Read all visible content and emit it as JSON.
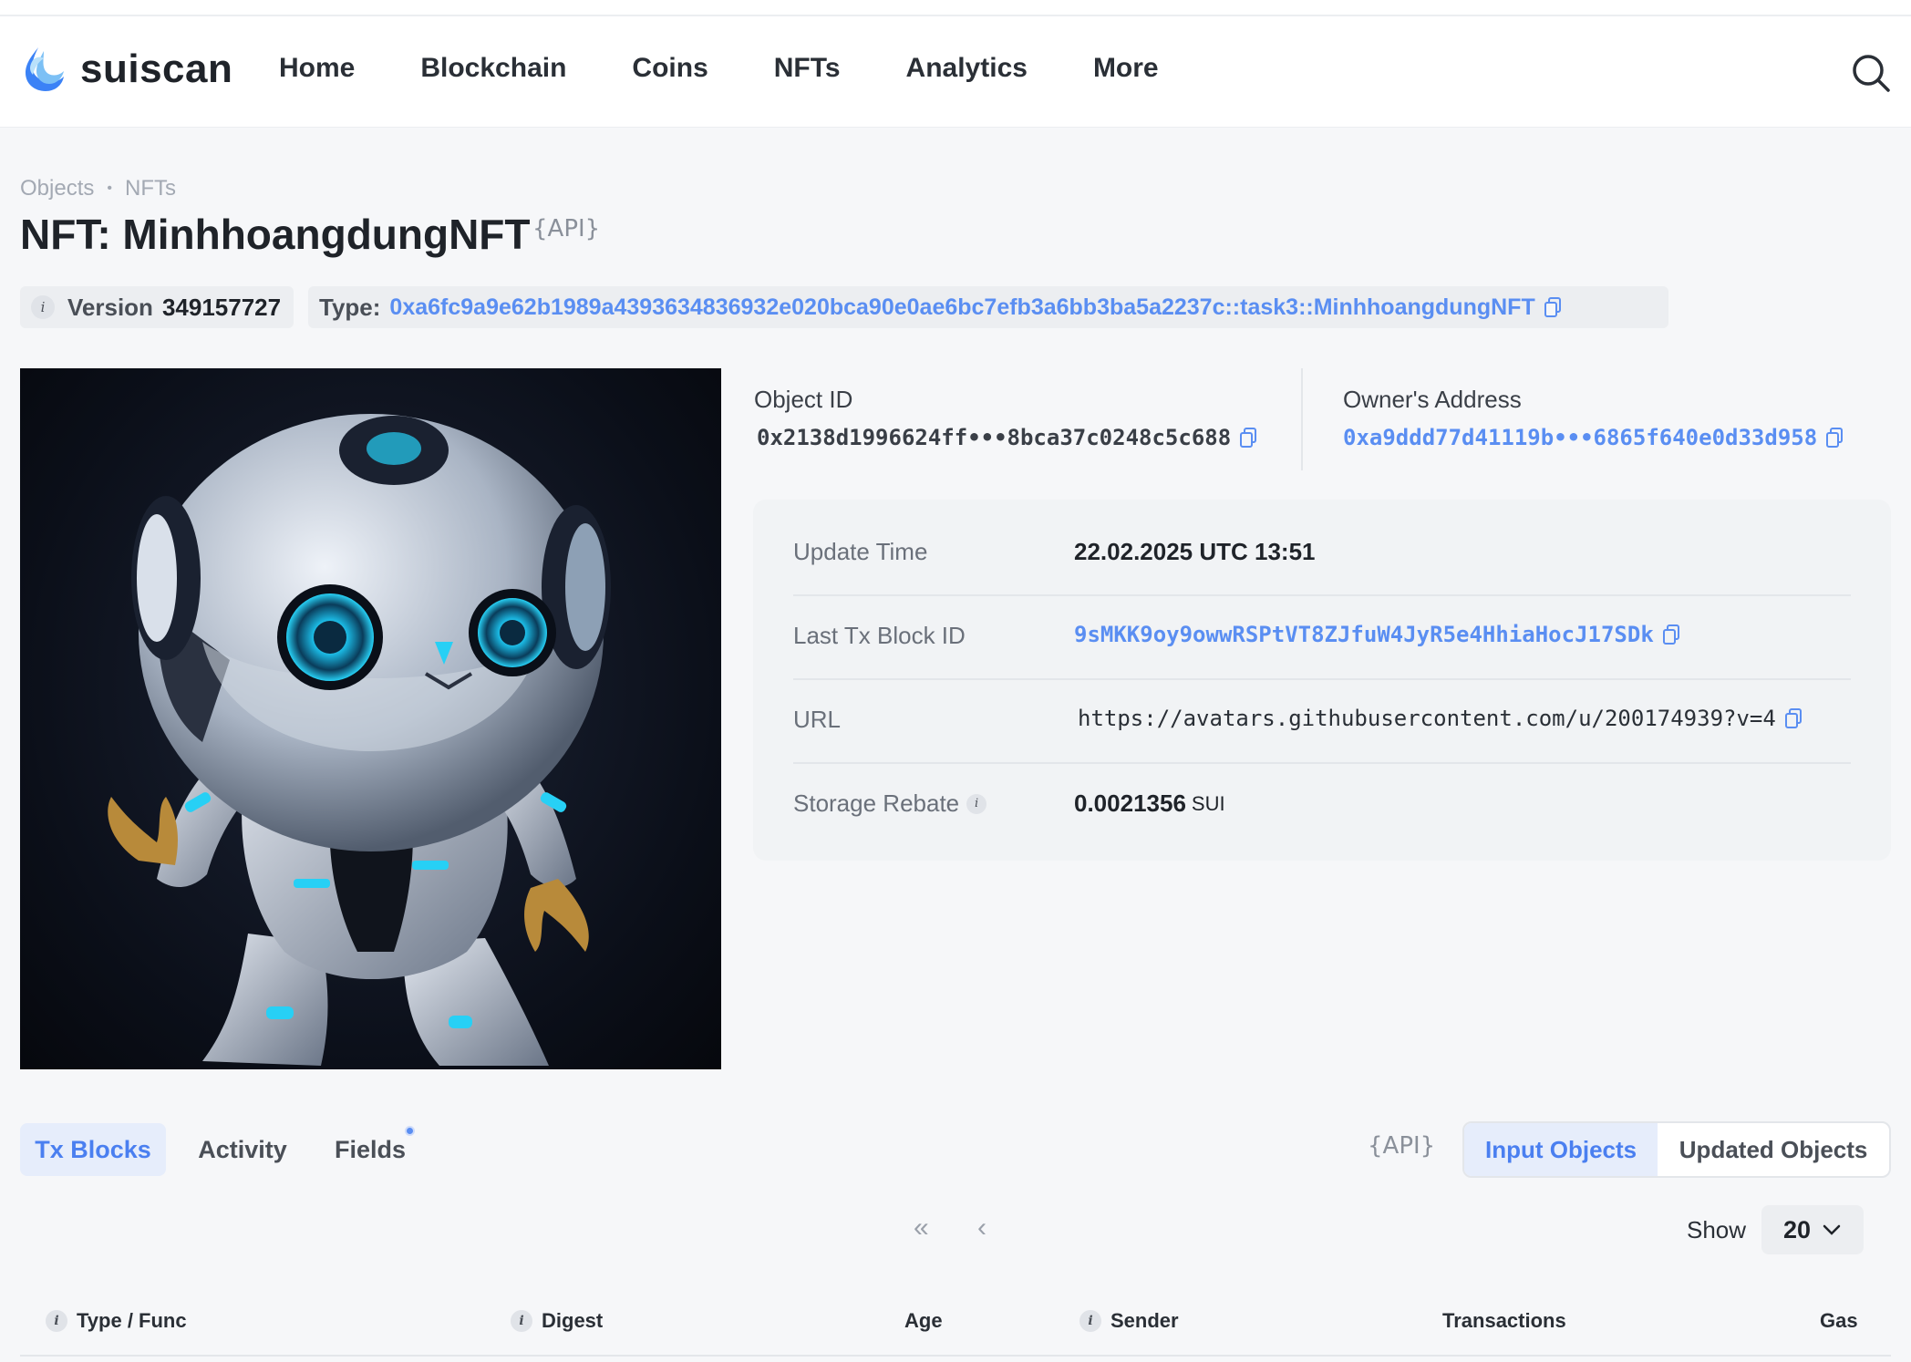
{
  "brand": {
    "name": "suiscan"
  },
  "nav": {
    "items": [
      "Home",
      "Blockchain",
      "Coins",
      "NFTs",
      "Analytics",
      "More"
    ]
  },
  "breadcrumb": {
    "items": [
      "Objects",
      "NFTs"
    ]
  },
  "page": {
    "title": "NFT: MinhhoangdungNFT",
    "api_label": "{API}"
  },
  "meta": {
    "version_label": "Version",
    "version_value": "349157727",
    "type_label": "Type:",
    "type_value": "0xa6fc9a9e62b1989a4393634836932e020bca90e0ae6bc7efb3a6bb3ba5a2237c::task3::MinhhoangdungNFT"
  },
  "object": {
    "object_id_label": "Object ID",
    "object_id_value": "0x2138d1996624ff•••8bca37c0248c5c688",
    "owner_label": "Owner's Address",
    "owner_value": "0xa9ddd77d41119b•••6865f640e0d33d958"
  },
  "details": {
    "update_time_label": "Update Time",
    "update_time_value": "22.02.2025 UTC 13:51",
    "last_tx_label": "Last Tx Block ID",
    "last_tx_value": "9sMKK9oy9owwRSPtVT8ZJfuW4JyR5e4HhiaHocJ17SDk",
    "url_label": "URL",
    "url_value": "https://avatars.githubusercontent.com/u/200174939?v=4",
    "storage_rebate_label": "Storage Rebate",
    "storage_rebate_value": "0.0021356",
    "storage_rebate_unit": "SUI"
  },
  "tabs": {
    "items": [
      "Tx Blocks",
      "Activity",
      "Fields"
    ],
    "active": "Tx Blocks"
  },
  "toggle": {
    "api_label": "{API}",
    "input_label": "Input Objects",
    "updated_label": "Updated Objects",
    "active": "Input Objects"
  },
  "pagination": {
    "first": "«",
    "prev": "‹",
    "show_label": "Show",
    "page_size": "20"
  },
  "table": {
    "columns": [
      "Type / Func",
      "Digest",
      "Age",
      "Sender",
      "Transactions",
      "Gas"
    ]
  },
  "colors": {
    "link": "#5a8ef2",
    "accent": "#4a7ff0",
    "active_bg": "#e6edfb"
  },
  "icons": [
    "sui-logo-icon",
    "search-icon",
    "info-icon",
    "copy-icon",
    "chevron-down-icon"
  ]
}
